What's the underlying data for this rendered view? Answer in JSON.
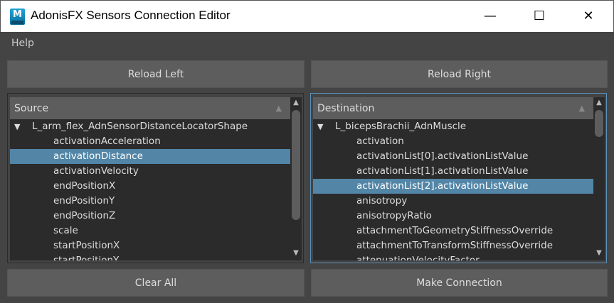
{
  "window": {
    "title": "AdonisFX Sensors Connection Editor",
    "logo": "M"
  },
  "menu": {
    "help": "Help"
  },
  "buttons": {
    "reload_left": "Reload Left",
    "reload_right": "Reload Right",
    "clear_all": "Clear All",
    "make_connection": "Make Connection"
  },
  "source": {
    "header": "Source",
    "root": "L_arm_flex_AdnSensorDistanceLocatorShape",
    "selected_index": 1,
    "items": [
      "activationAcceleration",
      "activationDistance",
      "activationVelocity",
      "endPositionX",
      "endPositionY",
      "endPositionZ",
      "scale",
      "startPositionX",
      "startPositionY"
    ]
  },
  "destination": {
    "header": "Destination",
    "root": "L_bicepsBrachii_AdnMuscle",
    "selected_index": 3,
    "items": [
      "activation",
      "activationList[0].activationListValue",
      "activationList[1].activationListValue",
      "activationList[2].activationListValue",
      "anisotropy",
      "anisotropyRatio",
      "attachmentToGeometryStiffnessOverride",
      "attachmentToTransformStiffnessOverride",
      "attenuationVelocityFactor"
    ]
  },
  "colors": {
    "selection": "#5285a6",
    "background": "#444444",
    "button": "#5d5d5d",
    "focus_border": "#5a8fb6"
  }
}
